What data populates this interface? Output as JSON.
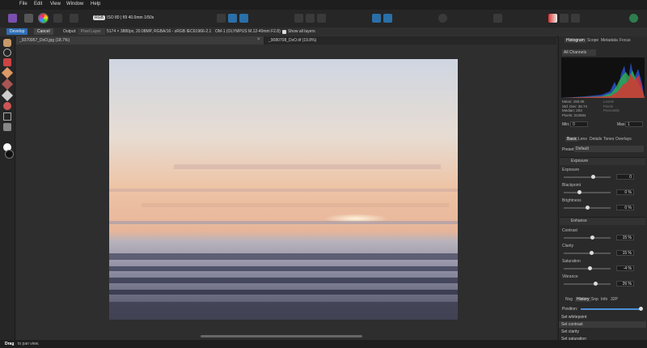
{
  "menu": [
    "File",
    "Edit",
    "View",
    "Window",
    "Help"
  ],
  "toolbar": {
    "mode_badge": "RGB",
    "exif": "ISO 80 | f/9 40.0mm 1/50s"
  },
  "context": {
    "develop": "Develop",
    "cancel": "Cancel",
    "output_label": "Output:",
    "output_value": "Pixel Layer",
    "info": "5174 × 3880px, 20.08MP, RGBA/16 - sRGB IEC61966-2.1",
    "camera": "OM-1 (OLYMPUS M.12-40mm F2.8)",
    "show_layers": "Show all layers"
  },
  "tabs": [
    {
      "label": "_9370957_DxO.jpg (18.7%)"
    },
    {
      "label": "_9080708_DxO.tif (19.8%)"
    }
  ],
  "panel": {
    "top_tabs": [
      "Histogram",
      "Scope",
      "Metadata",
      "Focus"
    ],
    "channel": "All Channels",
    "stats_left": [
      "Mean: 150.06",
      "Std. Dev: 38.74",
      "Median: 203",
      "Pixels: 312684"
    ],
    "stats_right": [
      "Levels",
      "Pixels",
      "Percentile"
    ],
    "min_label": "Min:",
    "min_value": "0",
    "max_label": "Max:",
    "max_value": "1",
    "dev_tabs": [
      "Basic",
      "Lens",
      "Details",
      "Tones",
      "Overlays"
    ],
    "preset_label": "Preset:",
    "preset_value": "Default",
    "exposure_title": "Exposure",
    "exposure": [
      {
        "label": "Exposure",
        "value": "0",
        "pct": 0.62
      },
      {
        "label": "Blackpoint",
        "value": "0 %",
        "pct": 0.33
      },
      {
        "label": "Brightness",
        "value": "0 %",
        "pct": 0.5
      }
    ],
    "enhance_title": "Enhance",
    "enhance": [
      {
        "label": "Contrast",
        "value": "15 %",
        "pct": 0.6
      },
      {
        "label": "Clarity",
        "value": "15 %",
        "pct": 0.58
      },
      {
        "label": "Saturation",
        "value": "-4 %",
        "pct": 0.56
      },
      {
        "label": "Vibrance",
        "value": "26 %",
        "pct": 0.67
      }
    ],
    "bottom_tabs": [
      "Nvg",
      "History",
      "Snp",
      "Info",
      "32P"
    ],
    "position_label": "Position:",
    "history": [
      "Set whitepoint",
      "Set contrast",
      "Set clarity",
      "Set saturation"
    ]
  },
  "status": {
    "strong": "Drag",
    "text": "to pan view."
  },
  "colors": {
    "accent": "#2a6fa8",
    "develop": "#2f6fb5"
  }
}
